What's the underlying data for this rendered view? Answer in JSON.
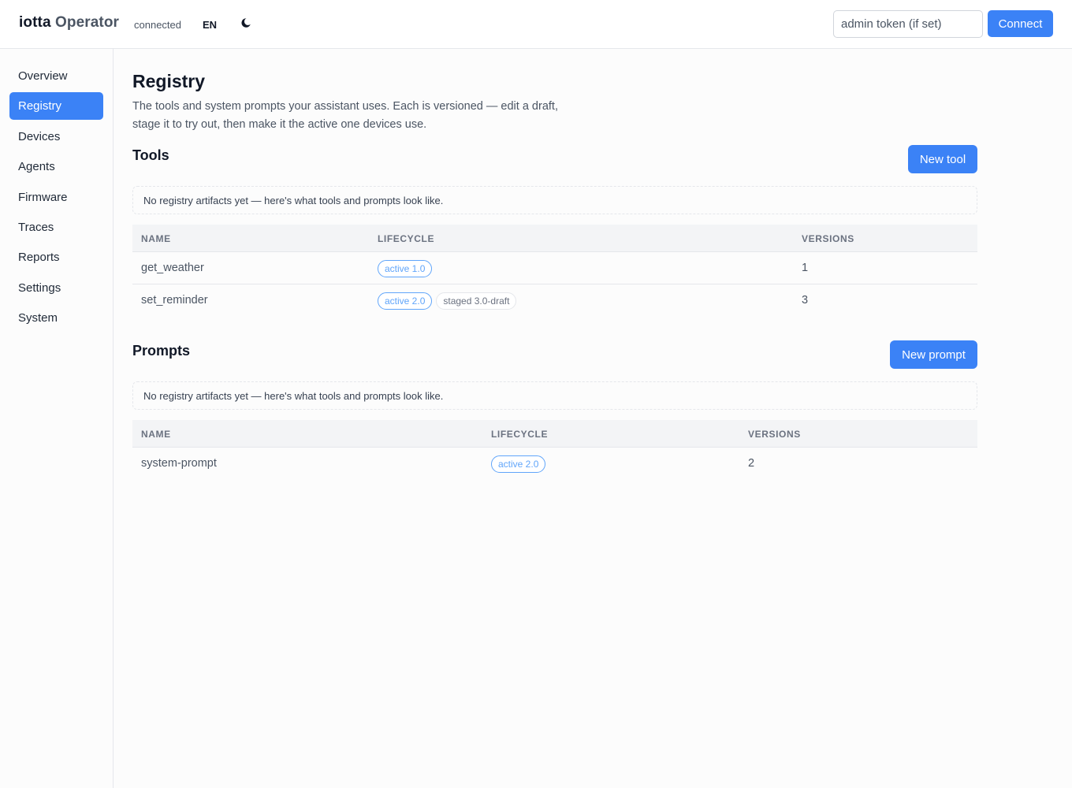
{
  "header": {
    "brand_name": "iotta",
    "brand_suffix": "Operator",
    "status": "connected",
    "language": "EN",
    "theme_icon": "moon-icon",
    "token_placeholder": "admin token (if set)",
    "connect_label": "Connect"
  },
  "sidebar": {
    "items": [
      {
        "label": "Overview",
        "active": false
      },
      {
        "label": "Registry",
        "active": true
      },
      {
        "label": "Devices",
        "active": false
      },
      {
        "label": "Agents",
        "active": false
      },
      {
        "label": "Firmware",
        "active": false
      },
      {
        "label": "Traces",
        "active": false
      },
      {
        "label": "Reports",
        "active": false
      },
      {
        "label": "Settings",
        "active": false
      },
      {
        "label": "System",
        "active": false
      }
    ]
  },
  "page": {
    "title": "Registry",
    "description": "The tools and system prompts your assistant uses. Each is versioned — edit a draft, stage it to try out, then make it the active one devices use."
  },
  "tools": {
    "title": "Tools",
    "new_label": "New tool",
    "notice": "No registry artifacts yet — here's what tools and prompts look like.",
    "columns": [
      "NAME",
      "LIFECYCLE",
      "VERSIONS"
    ],
    "rows": [
      {
        "name": "get_weather",
        "active": "active 1.0",
        "staged": "",
        "versions": "1"
      },
      {
        "name": "set_reminder",
        "active": "active 2.0",
        "staged": "staged 3.0-draft",
        "versions": "3"
      }
    ]
  },
  "prompts": {
    "title": "Prompts",
    "new_label": "New prompt",
    "notice": "No registry artifacts yet — here's what tools and prompts look like.",
    "columns": [
      "NAME",
      "LIFECYCLE",
      "VERSIONS"
    ],
    "rows": [
      {
        "name": "system-prompt",
        "active": "active 2.0",
        "staged": "",
        "versions": "2"
      }
    ]
  },
  "colors": {
    "accent": "#3b82f6",
    "badge_active": "#60a5fa",
    "border": "#e5e7eb"
  }
}
